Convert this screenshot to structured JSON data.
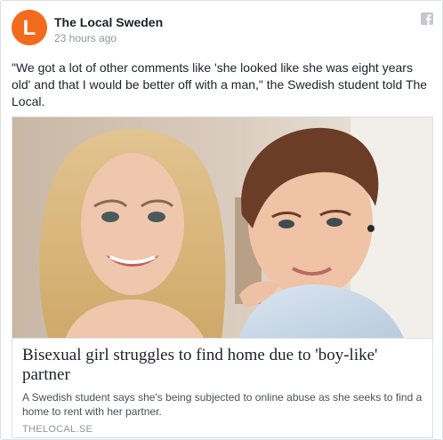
{
  "post": {
    "page_name": "The Local Sweden",
    "timestamp": "23 hours ago",
    "avatar_letter": "L",
    "text": "\"We got a lot of other comments like 'she looked like she was eight years old' and that I would be better off with a man,\" the Swedish student told The Local."
  },
  "link": {
    "title": "Bisexual girl struggles to find home due to 'boy-like' partner",
    "description": "A Swedish student says she's being subjected to online abuse as she seeks to find a home to rent with her partner.",
    "domain": "THELOCAL.SE",
    "image_icon": "photo-two-women"
  },
  "icons": {
    "avatar": "the-local-logo-icon",
    "network": "facebook-icon"
  },
  "colors": {
    "brand_orange": "#f26b1d",
    "name": "#1d2129",
    "meta": "#90949c",
    "border": "#dddfe2"
  }
}
